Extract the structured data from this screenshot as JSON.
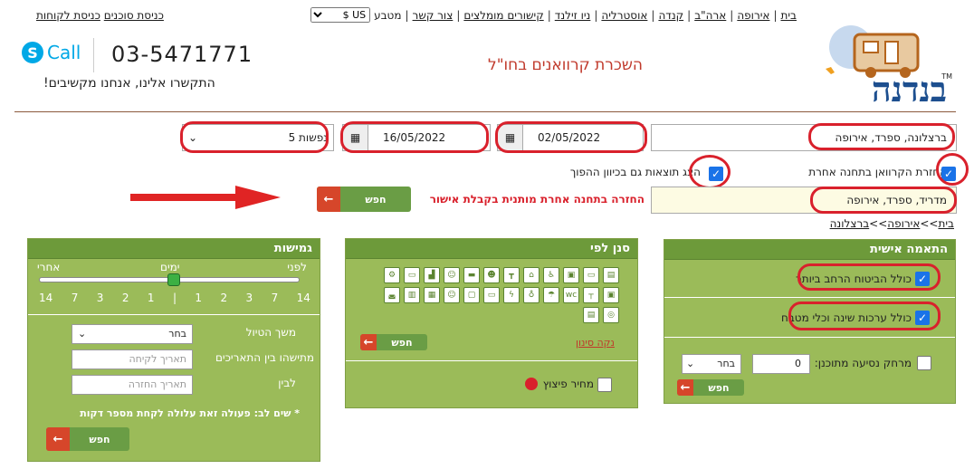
{
  "nav": {
    "items": [
      "בית",
      "אירופה",
      "ארה\"ב",
      "קנדה",
      "אוסטרליה",
      "ניו זילנד",
      "קישורים מומלצים",
      "צור קשר"
    ],
    "currency_label": "מטבע",
    "currency_value": "US $"
  },
  "top_links": [
    "כניסת סוכנים",
    "כניסת לקוחות"
  ],
  "brand": {
    "logo_text": "בנדנה",
    "tm": "TM",
    "slogan": "השכרת קרוואנים בחו\"ל"
  },
  "contact": {
    "call_label": "Call",
    "skype_letter": "S",
    "phone": "03-5471771",
    "text": "התקשרו אלינו, אנחנו מקשיבים!"
  },
  "search": {
    "location": "ברצלונה, ספרד, אירופה",
    "pickup_date": "02/05/2022",
    "return_date": "16/05/2022",
    "passengers": "5 נפשות",
    "return_other_label": "החזרת הקרוואן בתחנה אחרת",
    "reverse_label": "הצג תוצאות גם בכיוון ההפוך",
    "return_location": "מדריד, ספרד, אירופה",
    "return_note": "החזרה בתחנה אחרת מותנית בקבלת אישור",
    "search_btn": "חפש"
  },
  "breadcrumb": {
    "home": "בית",
    "sep": ">>",
    "europe": "אירופה",
    "city": "ברצלונה"
  },
  "personal": {
    "title": "התאמה אישית",
    "opt1": "כולל הביטוח הרחב ביותר",
    "opt2": "כולל ערכות שינה וכלי מטבח",
    "distance_label": "מרחק נסיעה מתוכנן:",
    "distance_value": "0",
    "distance_select": "בחר",
    "search_btn": "חפש"
  },
  "filter": {
    "title": "סנן לפי",
    "clear": "נקה סינון",
    "search_btn": "חפש",
    "compensation": "מחיר פיצוץ"
  },
  "flex": {
    "title": "גמישות",
    "before": "לפני",
    "days": "ימים",
    "after": "אחרי",
    "ticks": [
      "14",
      "7",
      "3",
      "2",
      "1",
      "|",
      "1",
      "2",
      "3",
      "7",
      "14"
    ],
    "trip_length_label": "משך הטיול",
    "trip_length_select": "בחר",
    "between_label": "מתישהו בין התאריכים",
    "pickup_placeholder": "תאריך לקיחה",
    "to_label": "לבין",
    "return_placeholder": "תאריך החזרה",
    "warning": "* שים לב: פעולה זאת עלולה לקחת מספר דקות",
    "search_btn": "חפש"
  }
}
